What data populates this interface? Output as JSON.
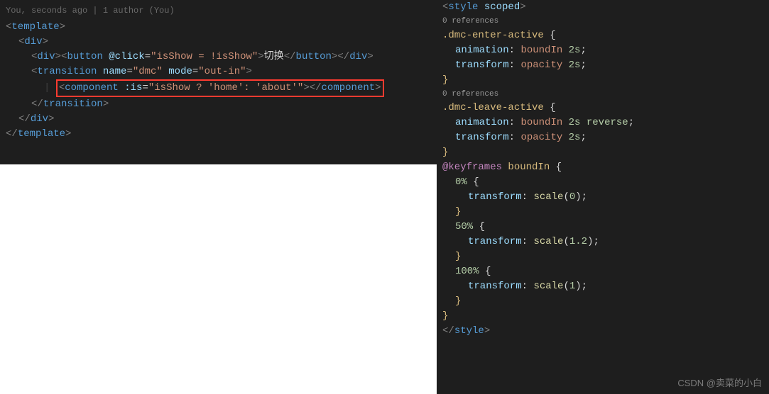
{
  "left": {
    "blame": "You, seconds ago | 1 author (You)",
    "lines": {
      "l1": {
        "open": "<",
        "tag": "template",
        "close": ">"
      },
      "l2": {
        "open": "<",
        "tag": "div",
        "close": ">"
      },
      "l3": {
        "open1": "<",
        "tag1": "div",
        "close1": ">",
        "open2": "<",
        "tag2": "button",
        "sp": " ",
        "attr": "@click",
        "eq": "=",
        "val": "\"isShow = !isShow\"",
        "close2": ">",
        "text": "切换",
        "open3": "</",
        "tag3": "button",
        "close3": ">",
        "open4": "</",
        "tag4": "div",
        "close4": ">"
      },
      "l4": {
        "open": "<",
        "tag": "transition",
        "sp": " ",
        "attr1": "name",
        "eq1": "=",
        "val1": "\"dmc\"",
        "sp2": " ",
        "attr2": "mode",
        "eq2": "=",
        "val2": "\"out-in\"",
        "close": ">"
      },
      "l5": {
        "open": "<",
        "tag": "component",
        "sp": " ",
        "attr": ":is",
        "eq": "=",
        "val": "\"isShow ? 'home': 'about'\"",
        "close": ">",
        "openc": "</",
        "tagc": "component",
        "closec": ">"
      },
      "l6": {
        "open": "</",
        "tag": "transition",
        "close": ">"
      },
      "l7": {
        "open": "</",
        "tag": "div",
        "close": ">"
      },
      "l8": {
        "open": "</",
        "tag": "template",
        "close": ">"
      }
    }
  },
  "right": {
    "lens": "0 references",
    "lines": {
      "r0": {
        "open": "<",
        "tag": "style",
        "sp": " ",
        "attr": "scoped",
        "close": ">"
      },
      "r1": {
        "sel": ".dmc-enter-active",
        "sp": " ",
        "brace": "{"
      },
      "r2": {
        "prop": "animation",
        "colon": ": ",
        "val": "boundIn ",
        "num": "2s",
        "semi": ";"
      },
      "r3": {
        "prop": "transform",
        "colon": ": ",
        "val": "opacity ",
        "num": "2s",
        "semi": ";"
      },
      "r4": {
        "brace": "}"
      },
      "r5": {
        "sel": ".dmc-leave-active",
        "sp": " ",
        "brace": "{"
      },
      "r6": {
        "prop": "animation",
        "colon": ": ",
        "val": "boundIn ",
        "num": "2s",
        "sp": " ",
        "kw": "reverse",
        "semi": ";"
      },
      "r7": {
        "prop": "transform",
        "colon": ": ",
        "val": "opacity ",
        "num": "2s",
        "semi": ";"
      },
      "r8": {
        "brace": "}"
      },
      "r9": {
        "kw": "@keyframes",
        "sp": " ",
        "sel": "boundIn",
        "sp2": " ",
        "brace": "{"
      },
      "r10": {
        "num": "0%",
        "sp": " ",
        "brace": "{"
      },
      "r11": {
        "prop": "transform",
        "colon": ": ",
        "fn": "scale",
        "paren": "(",
        "num": "0",
        "paren2": ")",
        "semi": ";"
      },
      "r12": {
        "brace": "}"
      },
      "r13": {
        "num": "50%",
        "sp": " ",
        "brace": "{"
      },
      "r14": {
        "prop": "transform",
        "colon": ": ",
        "fn": "scale",
        "paren": "(",
        "num": "1.2",
        "paren2": ")",
        "semi": ";"
      },
      "r15": {
        "brace": "}"
      },
      "r16": {
        "num": "100%",
        "sp": " ",
        "brace": "{"
      },
      "r17": {
        "prop": "transform",
        "colon": ": ",
        "fn": "scale",
        "paren": "(",
        "num": "1",
        "paren2": ")",
        "semi": ";"
      },
      "r18": {
        "brace": "}"
      },
      "r19": {
        "brace": "}"
      },
      "r20": {
        "open": "</",
        "tag": "style",
        "close": ">"
      }
    }
  },
  "watermark": "CSDN @卖菜的小白"
}
